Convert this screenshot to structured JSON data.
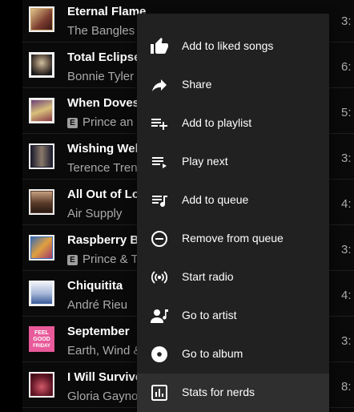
{
  "tracks": [
    {
      "title": "Eternal Flame",
      "artist": "The Bangles",
      "explicit": false,
      "duration": "3:",
      "art_colors": [
        "#c9a46a",
        "#7a3b2e"
      ],
      "art_icon": "album-art-eternal-flame"
    },
    {
      "title": "Total Eclipse",
      "artist": "Bonnie Tyler",
      "explicit": false,
      "duration": "6:",
      "art_colors": [
        "#f4f4f4",
        "#4a4a4a"
      ],
      "art_icon": "album-art-total-eclipse"
    },
    {
      "title": "When Doves",
      "artist": "Prince an",
      "explicit": true,
      "explicit_label": "E",
      "duration": "5:",
      "art_colors": [
        "#6b3f7a",
        "#d8c07a"
      ],
      "art_icon": "album-art-when-doves-cry"
    },
    {
      "title": "Wishing Wel",
      "artist": "Terence Tren",
      "explicit": false,
      "duration": "3:",
      "art_colors": [
        "#1c1c2e",
        "#8a7a6a"
      ],
      "art_icon": "album-art-wishing-well"
    },
    {
      "title": "All Out of Lo",
      "artist": "Air Supply",
      "explicit": false,
      "duration": "4:",
      "art_colors": [
        "#5a3a2a",
        "#c8a080"
      ],
      "art_icon": "album-art-all-out-of-love"
    },
    {
      "title": "Raspberry B",
      "artist": "Prince & T",
      "explicit": true,
      "explicit_label": "E",
      "duration": "3:",
      "art_colors": [
        "#3a6ab0",
        "#e0a040"
      ],
      "art_icon": "album-art-raspberry-beret"
    },
    {
      "title": "Chiquitita",
      "artist": "André Rieu",
      "explicit": false,
      "duration": "4:",
      "art_colors": [
        "#e8eef5",
        "#3a5a9a"
      ],
      "art_icon": "album-art-chiquitita"
    },
    {
      "title": "September",
      "artist": "Earth, Wind &",
      "explicit": false,
      "duration": "3:",
      "art_colors": [
        "#e85a9a",
        "#ffffff"
      ],
      "art_text": [
        "FEEL",
        "GOOD",
        "FRIDAY"
      ],
      "art_icon": "album-art-september"
    },
    {
      "title": "I Will Survive",
      "artist": "Gloria Gaynor",
      "explicit": false,
      "duration": "8:",
      "art_colors": [
        "#6a1a2a",
        "#d05a6a"
      ],
      "art_icon": "album-art-i-will-survive"
    }
  ],
  "menu": {
    "items": [
      {
        "label": "Add to liked songs",
        "icon": "thumb-up-icon"
      },
      {
        "label": "Share",
        "icon": "share-icon"
      },
      {
        "label": "Add to playlist",
        "icon": "playlist-add-icon"
      },
      {
        "label": "Play next",
        "icon": "play-next-icon"
      },
      {
        "label": "Add to queue",
        "icon": "add-to-queue-icon"
      },
      {
        "label": "Remove from queue",
        "icon": "remove-circle-icon"
      },
      {
        "label": "Start radio",
        "icon": "radio-icon"
      },
      {
        "label": "Go to artist",
        "icon": "artist-icon"
      },
      {
        "label": "Go to album",
        "icon": "album-icon"
      },
      {
        "label": "Stats for nerds",
        "icon": "stats-icon",
        "selected": true
      }
    ]
  },
  "colors": {
    "background": "#000000",
    "menu_background": "#212121",
    "menu_selected": "#2f2f2f",
    "primary_text": "#ffffff",
    "secondary_text": "#aaaaaa"
  }
}
